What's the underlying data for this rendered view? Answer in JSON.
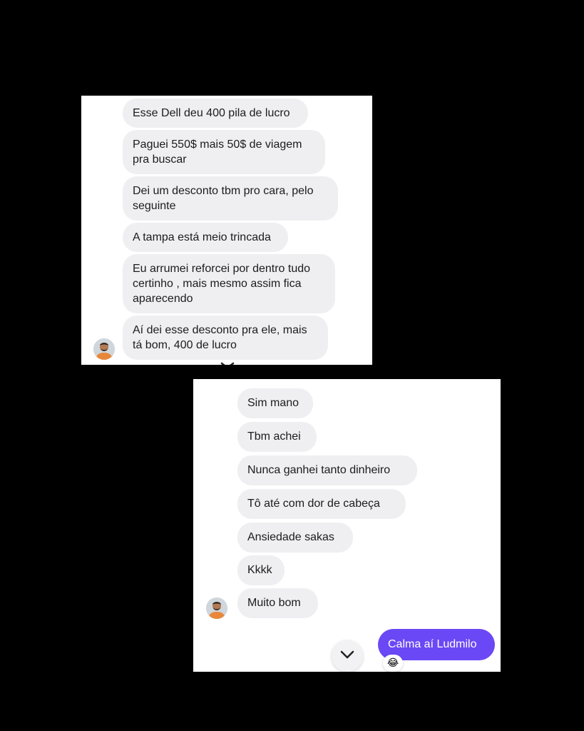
{
  "panel_top": {
    "messages": [
      {
        "lines": [
          "Esse Dell deu 400 pila de lucro"
        ]
      },
      {
        "lines": [
          "Paguei 550$ mais 50$ de viagem",
          "pra buscar"
        ]
      },
      {
        "lines": [
          "Dei um desconto tbm pro cara, pelo",
          "seguinte"
        ]
      },
      {
        "lines": [
          "A tampa está meio trincada"
        ]
      },
      {
        "lines": [
          "Eu arrumei reforcei por dentro tudo",
          "certinho , mais mesmo assim fica",
          "aparecendo"
        ]
      },
      {
        "lines": [
          "Aí dei esse desconto pra ele, mais",
          "tá bom, 400 de lucro"
        ]
      }
    ],
    "avatar_icon": "user-avatar-icon"
  },
  "panel_bottom": {
    "messages": [
      {
        "lines": [
          "Sim mano"
        ]
      },
      {
        "lines": [
          "Tbm achei"
        ]
      },
      {
        "lines": [
          "Nunca ganhei tanto dinheiro"
        ]
      },
      {
        "lines": [
          "Tô até com dor de cabeça"
        ]
      },
      {
        "lines": [
          "Ansiedade sakas"
        ]
      },
      {
        "lines": [
          "Kkkk"
        ]
      },
      {
        "lines": [
          "Muito bom"
        ]
      }
    ],
    "sent_message": "Calma aí Ludmilo",
    "reaction": "😂",
    "scroll_icon": "chevron-down-icon",
    "avatar_icon": "user-avatar-icon"
  },
  "colors": {
    "background": "#000000",
    "received_bubble": "#efeff2",
    "sent_bubble": "#6a48f5"
  }
}
